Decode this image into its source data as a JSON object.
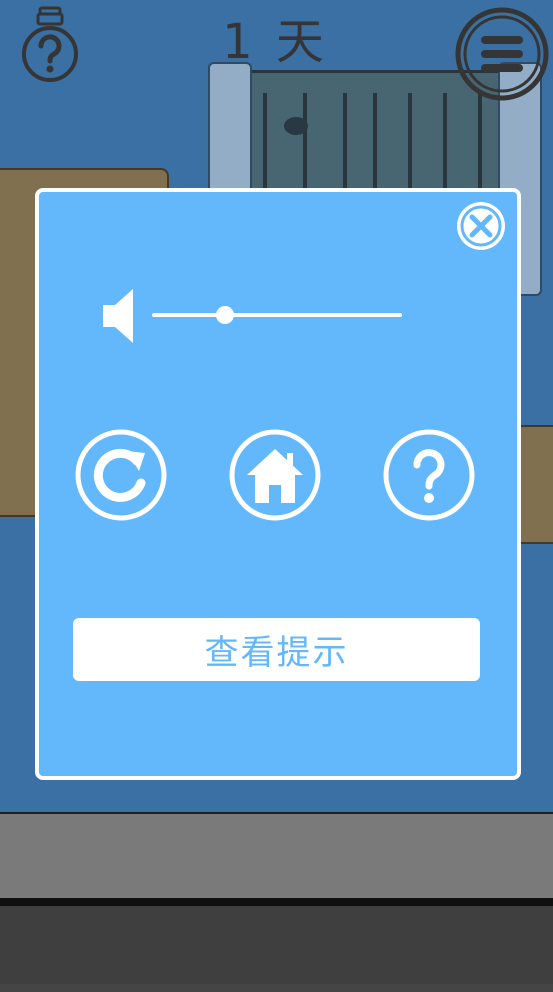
{
  "hud": {
    "day_label": "1 天",
    "hint_icon": "lightbulb-question-icon",
    "menu_icon": "hamburger-menu-icon"
  },
  "dialog": {
    "close_icon": "close-icon",
    "volume": {
      "icon": "speaker-icon",
      "level": 0.29
    },
    "buttons": [
      {
        "name": "restart",
        "icon": "restart-icon"
      },
      {
        "name": "home",
        "icon": "home-icon"
      },
      {
        "name": "help",
        "icon": "question-icon"
      }
    ],
    "view_hint_label": "查看提示"
  },
  "colors": {
    "dialog_bg": "#63b8fb",
    "wall": "#3f7ab1",
    "white": "#ffffff"
  }
}
